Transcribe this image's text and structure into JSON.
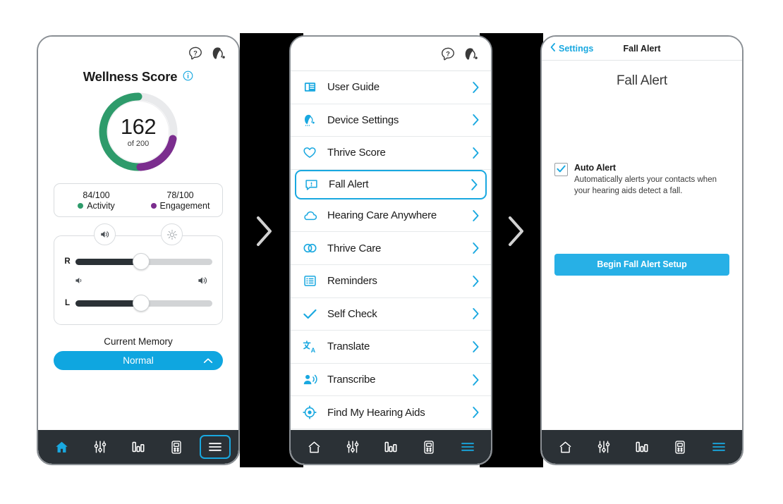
{
  "colors": {
    "accent": "#19a8e0",
    "memory_button": "#0fa6e0",
    "setup_button": "#27b0e6",
    "activity_green": "#2e9b6b",
    "engagement_purple": "#7b2d8e",
    "nav_background": "#2b3136",
    "track_gray": "#d2d4d6"
  },
  "phone1": {
    "header": {
      "help_icon": "question-bubble-icon",
      "device_icon": "hearing-aid-icon"
    },
    "wellness": {
      "title": "Wellness Score",
      "info_icon": "info-icon",
      "score": "162",
      "score_of": "of 200",
      "max": 200
    },
    "stats": [
      {
        "value": "84/100",
        "label": "Activity",
        "color": "#2e9b6b"
      },
      {
        "value": "78/100",
        "label": "Engagement",
        "color": "#7b2d8e"
      }
    ],
    "controls": {
      "volume_circle_icon": "speaker-icon",
      "brightness_circle_icon": "noise-icon",
      "right_label": "R",
      "left_label": "L",
      "right_value": 48,
      "left_value": 48,
      "vol_down_icon": "volume-down-icon",
      "vol_up_icon": "volume-up-icon"
    },
    "memory": {
      "label": "Current Memory",
      "value": "Normal",
      "chevron_icon": "chevron-up-icon"
    },
    "nav": [
      {
        "name": "home",
        "icon": "home-icon",
        "state": "active"
      },
      {
        "name": "equalizer",
        "icon": "sliders-icon",
        "state": "idle"
      },
      {
        "name": "stats",
        "icon": "bar-chart-icon",
        "state": "idle"
      },
      {
        "name": "remote",
        "icon": "remote-icon",
        "state": "idle"
      },
      {
        "name": "menu",
        "icon": "hamburger-icon",
        "state": "selected"
      }
    ]
  },
  "phone2": {
    "header": {
      "help_icon": "question-bubble-icon",
      "device_icon": "hearing-aid-icon"
    },
    "menu_items": [
      {
        "label": "User Guide",
        "icon": "book-icon",
        "selected": false
      },
      {
        "label": "Device Settings",
        "icon": "hearing-aid-icon",
        "selected": false
      },
      {
        "label": "Thrive Score",
        "icon": "heart-icon",
        "selected": false
      },
      {
        "label": "Fall Alert",
        "icon": "alert-bubble-icon",
        "selected": true
      },
      {
        "label": "Hearing Care Anywhere",
        "icon": "cloud-icon",
        "selected": false
      },
      {
        "label": "Thrive Care",
        "icon": "two-rings-icon",
        "selected": false
      },
      {
        "label": "Reminders",
        "icon": "list-icon",
        "selected": false
      },
      {
        "label": "Self Check",
        "icon": "check-icon",
        "selected": false
      },
      {
        "label": "Translate",
        "icon": "translate-icon",
        "selected": false
      },
      {
        "label": "Transcribe",
        "icon": "transcribe-icon",
        "selected": false
      },
      {
        "label": "Find My Hearing Aids",
        "icon": "locate-icon",
        "selected": false
      }
    ],
    "chevron_icon": "chevron-right-icon",
    "nav": [
      {
        "name": "home",
        "icon": "home-icon",
        "state": "idle"
      },
      {
        "name": "equalizer",
        "icon": "sliders-icon",
        "state": "idle"
      },
      {
        "name": "stats",
        "icon": "bar-chart-icon",
        "state": "idle"
      },
      {
        "name": "remote",
        "icon": "remote-icon",
        "state": "idle"
      },
      {
        "name": "menu",
        "icon": "hamburger-icon",
        "state": "active"
      }
    ]
  },
  "phone3": {
    "nav_back_label": "Settings",
    "nav_back_icon": "chevron-left-icon",
    "nav_title": "Fall Alert",
    "page_title": "Fall Alert",
    "auto_alert": {
      "checked": true,
      "check_icon": "checkmark-icon",
      "title": "Auto Alert",
      "description": "Automatically alerts your contacts when your hearing aids detect a fall."
    },
    "setup_button": "Begin Fall Alert Setup",
    "nav": [
      {
        "name": "home",
        "icon": "home-icon",
        "state": "idle"
      },
      {
        "name": "equalizer",
        "icon": "sliders-icon",
        "state": "idle"
      },
      {
        "name": "stats",
        "icon": "bar-chart-icon",
        "state": "idle"
      },
      {
        "name": "remote",
        "icon": "remote-icon",
        "state": "idle"
      },
      {
        "name": "menu",
        "icon": "hamburger-icon",
        "state": "active"
      }
    ]
  },
  "separators": [
    {
      "icon": "chevron-right-icon"
    },
    {
      "icon": "chevron-right-icon"
    }
  ]
}
